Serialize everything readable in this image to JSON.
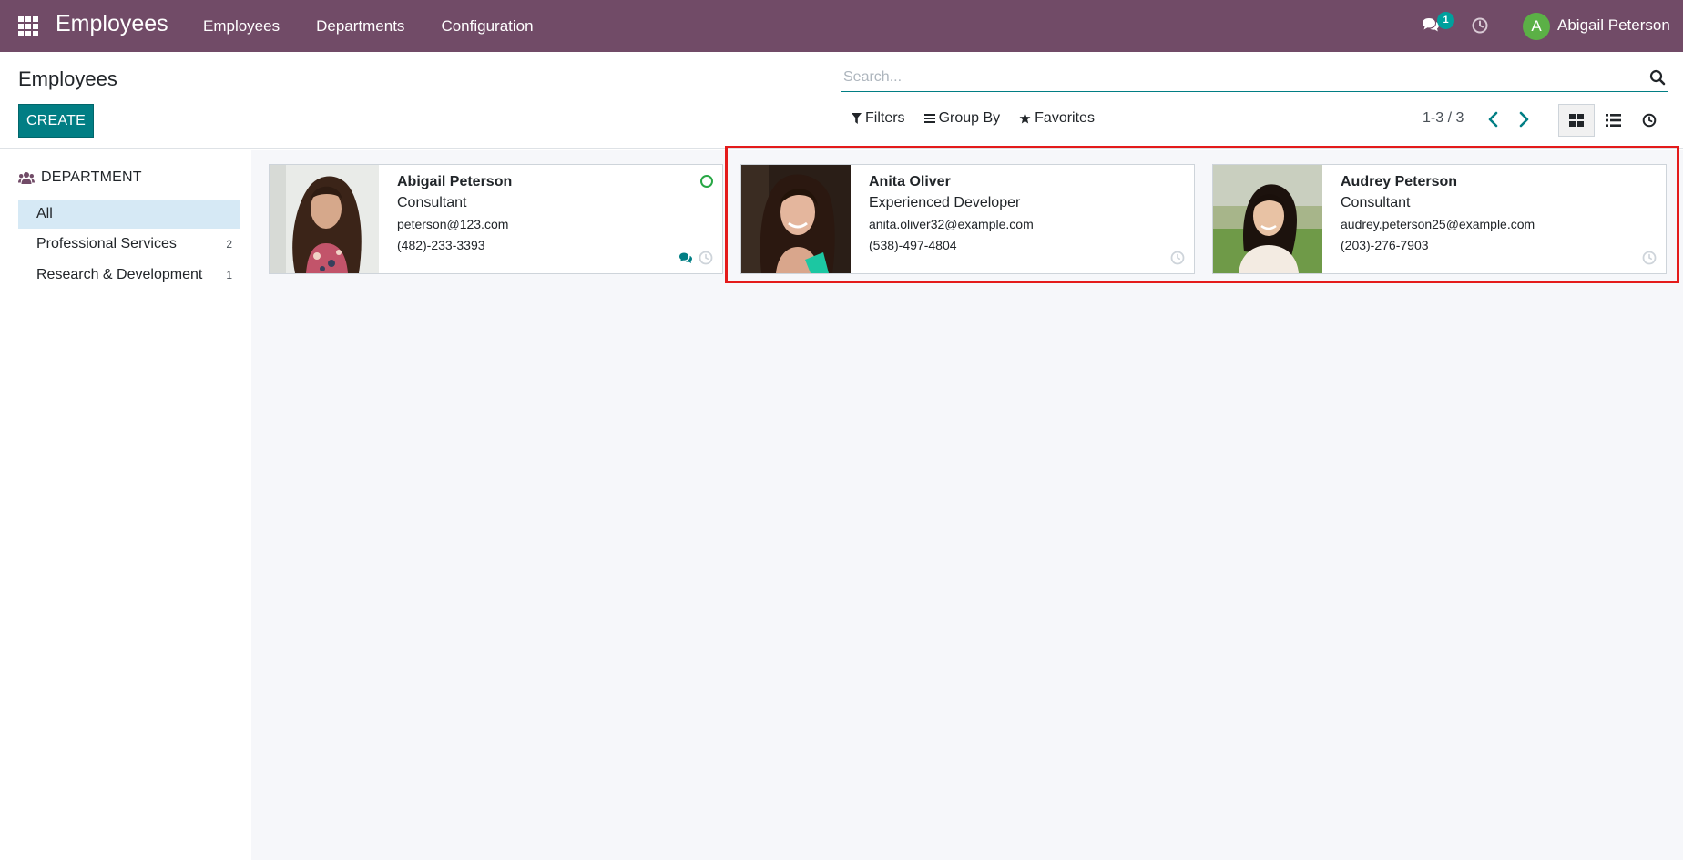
{
  "navbar": {
    "brand": "Employees",
    "menu": [
      "Employees",
      "Departments",
      "Configuration"
    ],
    "chat_badge": "1",
    "user_initial": "A",
    "user_name": "Abigail Peterson",
    "color": "#714B67"
  },
  "control_panel": {
    "title": "Employees",
    "create_label": "CREATE",
    "search_placeholder": "Search...",
    "filters_label": "Filters",
    "group_by_label": "Group By",
    "favorites_label": "Favorites",
    "pager": "1-3 / 3",
    "active_view": "kanban"
  },
  "sidebar": {
    "header": "DEPARTMENT",
    "items": [
      {
        "label": "All",
        "count": "",
        "active": true
      },
      {
        "label": "Professional Services",
        "count": "2",
        "active": false
      },
      {
        "label": "Research & Development",
        "count": "1",
        "active": false
      }
    ]
  },
  "employees": [
    {
      "name": "Abigail Peterson",
      "job": "Consultant",
      "email": "peterson@123.com",
      "phone": "(482)-233-3393",
      "online": true,
      "has_chat": true
    },
    {
      "name": "Anita Oliver",
      "job": "Experienced Developer",
      "email": "anita.oliver32@example.com",
      "phone": "(538)-497-4804",
      "online": false,
      "has_chat": false
    },
    {
      "name": "Audrey Peterson",
      "job": "Consultant",
      "email": "audrey.peterson25@example.com",
      "phone": "(203)-276-7903",
      "online": false,
      "has_chat": false
    }
  ],
  "colors": {
    "accent": "#017E84",
    "highlight": "#e41b1b",
    "online": "#28a745"
  }
}
